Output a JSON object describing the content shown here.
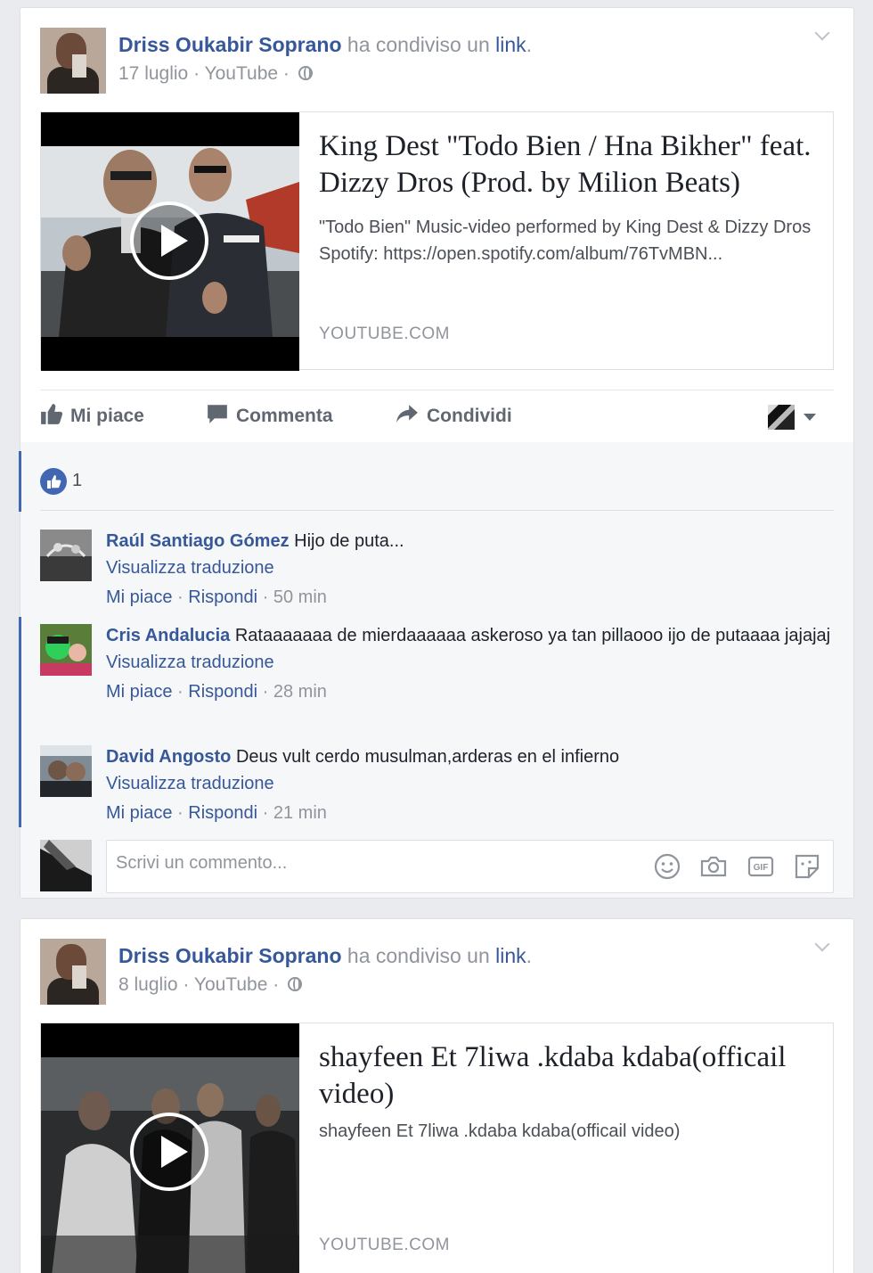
{
  "colors": {
    "link": "#365899",
    "muted": "#90949c",
    "accent": "#4267b2",
    "page_bg": "#e9ebee"
  },
  "icons": [
    "chevron-down-icon",
    "globe-icon",
    "play-icon",
    "like-icon",
    "comment-icon",
    "share-icon",
    "smiley-icon",
    "camera-icon",
    "gif-icon",
    "sticker-icon"
  ],
  "posts": [
    {
      "author": "Driss Oukabir Soprano",
      "shared_text": "ha condiviso un",
      "link_word": "link",
      "link_end": ".",
      "date": "17 luglio",
      "source": "YouTube",
      "sep": " · ",
      "card": {
        "title": "King Dest \"Todo Bien / Hna Bikher\" feat. Dizzy Dros (Prod. by Milion Beats)",
        "description": "\"Todo Bien\" Music-video performed by King Dest & Dizzy Dros Spotify: https://open.spotify.com/album/76TvMBN...",
        "domain": "YOUTUBE.COM"
      },
      "actions": {
        "like": "Mi piace",
        "comment": "Commenta",
        "share": "Condividi"
      },
      "like_count": "1",
      "comments": [
        {
          "name": "Raúl Santiago Gómez",
          "text": "Hijo de puta...",
          "translate": "Visualizza traduzione",
          "like": "Mi piace",
          "reply": "Rispondi",
          "time": "50 min"
        },
        {
          "name": "Cris Andalucia",
          "text": "Rataaaaaaa de mierdaaaaaa askeroso ya tan pillaooo ijo de putaaaa jajajaj",
          "translate": "Visualizza traduzione",
          "like": "Mi piace",
          "reply": "Rispondi",
          "time": "28 min"
        },
        {
          "name": "David Angosto",
          "text": "Deus vult cerdo musulman,arderas en el infierno",
          "translate": "Visualizza traduzione",
          "like": "Mi piace",
          "reply": "Rispondi",
          "time": "21 min"
        }
      ],
      "comment_placeholder": "Scrivi un commento..."
    },
    {
      "author": "Driss Oukabir Soprano",
      "shared_text": "ha condiviso un",
      "link_word": "link",
      "link_end": ".",
      "date": "8 luglio",
      "source": "YouTube",
      "sep": " · ",
      "card": {
        "title": "shayfeen Et 7liwa .kdaba kdaba(officail video)",
        "description": "shayfeen Et 7liwa .kdaba kdaba(officail video)",
        "domain": "YOUTUBE.COM"
      }
    }
  ]
}
